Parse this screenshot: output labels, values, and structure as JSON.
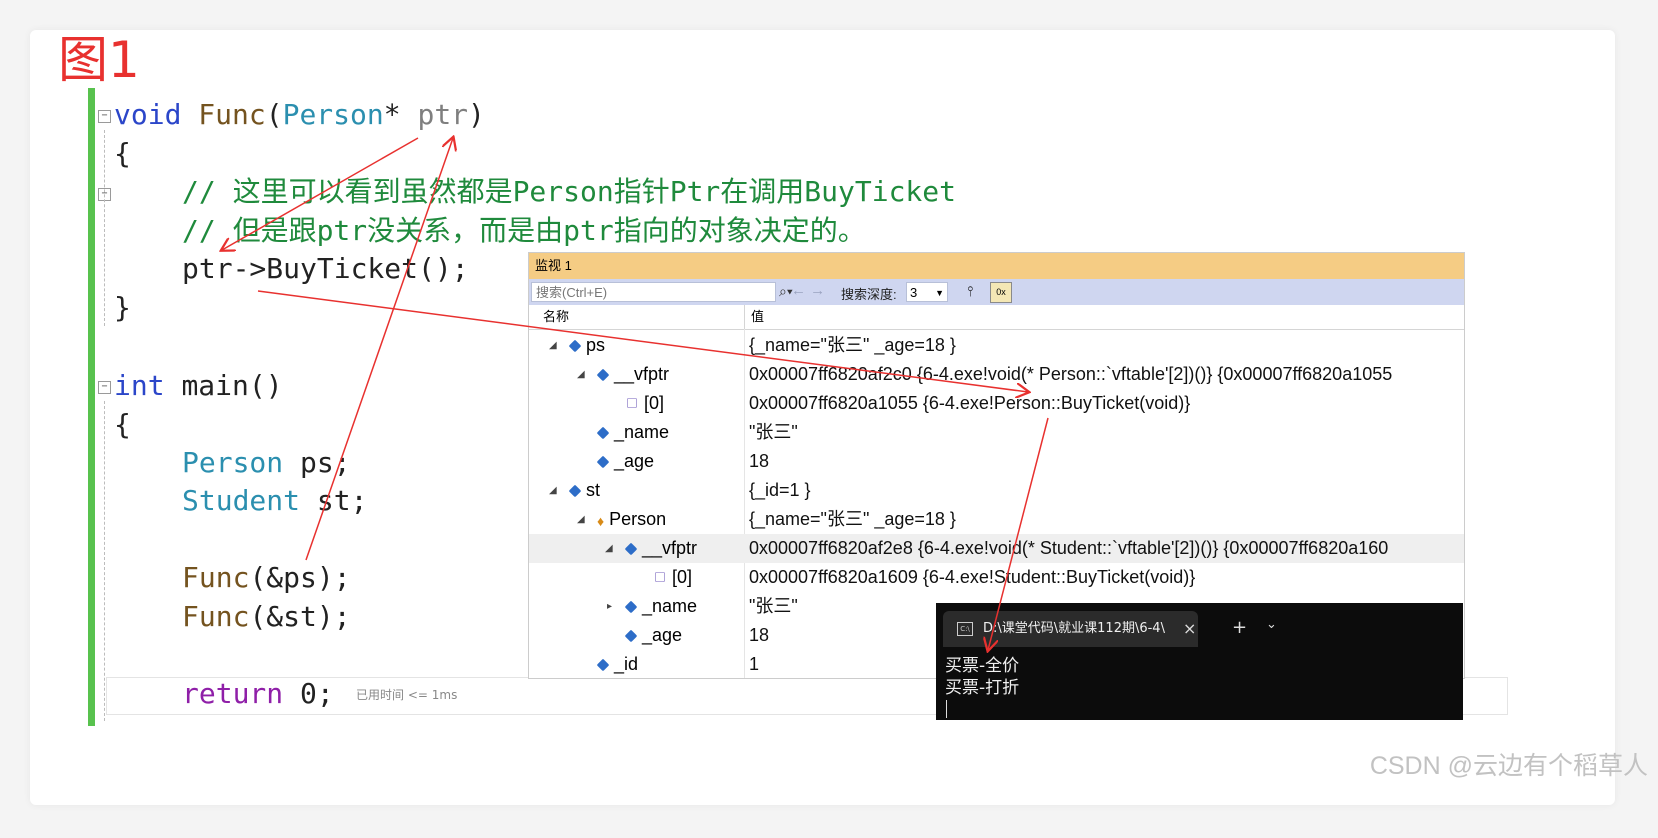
{
  "figure_label": "图1",
  "code": {
    "func_kw": "void",
    "func_name": "Func",
    "param_type": "Person",
    "param_star": "*",
    "param_name": "ptr",
    "comment1": "// 这里可以看到虽然都是Person指针Ptr在调用BuyTicket",
    "comment2": "// 但是跟ptr没关系，而是由ptr指向的对象决定的。",
    "call_stmt": "ptr->BuyTicket();",
    "main_kw": "int",
    "main_name": "main()",
    "ps_type": "Person",
    "ps_var": "ps",
    "st_type": "Student",
    "st_var": "st",
    "call1_fn": "Func",
    "call1_arg": "(&ps);",
    "call2_fn": "Func",
    "call2_arg": "(&st);",
    "return_kw": "return",
    "return_val": "0;",
    "open_brace": "{",
    "close_brace": "}",
    "elapsed": "已用时间 <= 1ms"
  },
  "watch": {
    "title": "监视 1",
    "search_placeholder": "搜索(Ctrl+E)",
    "depth_label": "搜索深度:",
    "depth_value": "3",
    "col_name": "名称",
    "col_value": "值",
    "rows": [
      {
        "name": "ps",
        "value": "{_name=\"张三\" _age=18 }"
      },
      {
        "name": "__vfptr",
        "value": "0x00007ff6820af2c0 {6-4.exe!void(* Person::`vftable'[2])()} {0x00007ff6820a1055"
      },
      {
        "name": "[0]",
        "value": "0x00007ff6820a1055 {6-4.exe!Person::BuyTicket(void)}"
      },
      {
        "name": "_name",
        "value": "\"张三\""
      },
      {
        "name": "_age",
        "value": "18"
      },
      {
        "name": "st",
        "value": "{_id=1 }"
      },
      {
        "name": "Person",
        "value": "{_name=\"张三\" _age=18 }"
      },
      {
        "name": "__vfptr",
        "value": "0x00007ff6820af2e8 {6-4.exe!void(* Student::`vftable'[2])()} {0x00007ff6820a160"
      },
      {
        "name": "[0]",
        "value": "0x00007ff6820a1609 {6-4.exe!Student::BuyTicket(void)}"
      },
      {
        "name": "_name",
        "value": "\"张三\""
      },
      {
        "name": "_age",
        "value": "18"
      },
      {
        "name": "_id",
        "value": "1"
      }
    ]
  },
  "terminal": {
    "tab_title": "D:\\课堂代码\\就业课112期\\6-4\\",
    "line1": "买票-全价",
    "line2": "买票-打折"
  },
  "watermark": "CSDN @云边有个稻草人",
  "colors": {
    "annotation": "#e8312f",
    "watch_title_bg": "#f5cc84",
    "toolbar_bg": "#cfd6f0",
    "margin_green": "#58c24e"
  }
}
